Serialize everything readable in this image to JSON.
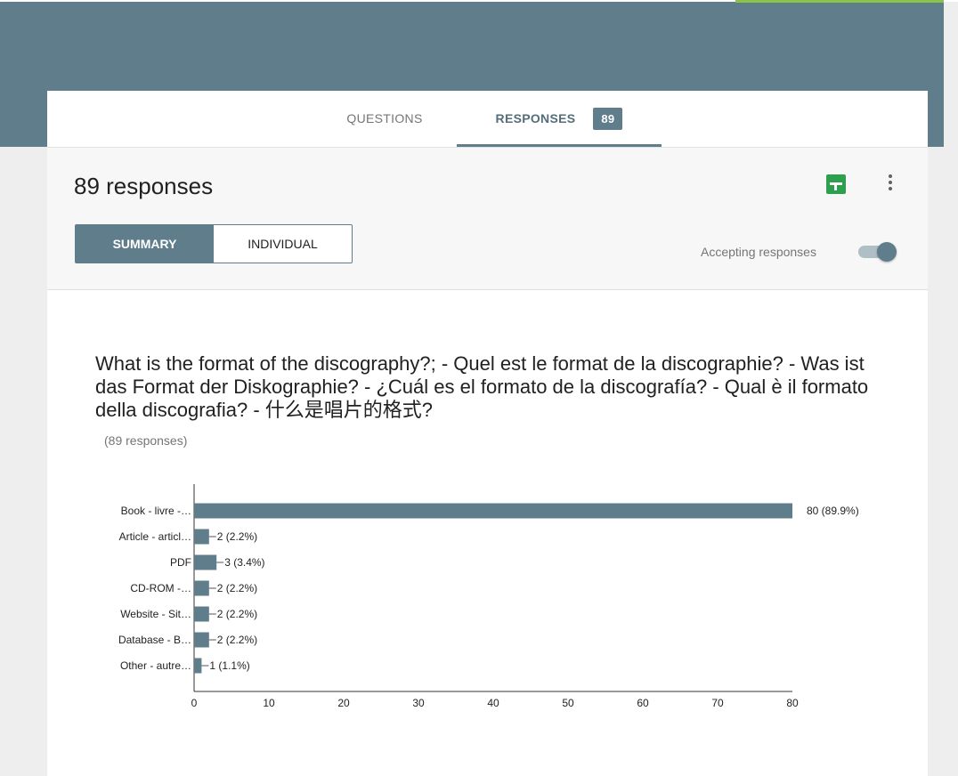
{
  "tabs": {
    "questions_label": "QUESTIONS",
    "responses_label": "RESPONSES",
    "responses_badge": "89"
  },
  "summary": {
    "title": "89 responses",
    "summary_label": "SUMMARY",
    "individual_label": "INDIVIDUAL",
    "accepting_label": "Accepting responses",
    "accepting_on": true
  },
  "question": {
    "text": "What is the format of the discography?; - Quel est le format de la discographie? - Was ist das Format der Diskographie? - ¿Cuál es el formato de la discografía? - Qual è il formato della discografia? - 什么是唱片的格式?",
    "count_label": "(89 responses)"
  },
  "colors": {
    "header_bg": "#607d8b",
    "accent_green": "#8bc34a",
    "bar": "#607d8b",
    "sheets_icon": "#2e9e4f"
  },
  "icons": [
    "sheets-icon",
    "more-vert-icon"
  ],
  "chart_data": {
    "type": "bar",
    "orientation": "horizontal",
    "categories": [
      "Book - livre -…",
      "Article - articl…",
      "PDF",
      "CD-ROM -…",
      "Website - Sit…",
      "Database - B…",
      "Other - autre…"
    ],
    "values": [
      80,
      2,
      3,
      2,
      2,
      2,
      1
    ],
    "data_labels": [
      "80 (89.9%)",
      "2 (2.2%)",
      "3 (3.4%)",
      "2 (2.2%)",
      "2 (2.2%)",
      "2 (2.2%)",
      "1 (1.1%)"
    ],
    "xlim": [
      0,
      80
    ],
    "xticks": [
      0,
      10,
      20,
      30,
      40,
      50,
      60,
      70,
      80
    ],
    "grid": false,
    "legend": "none"
  }
}
